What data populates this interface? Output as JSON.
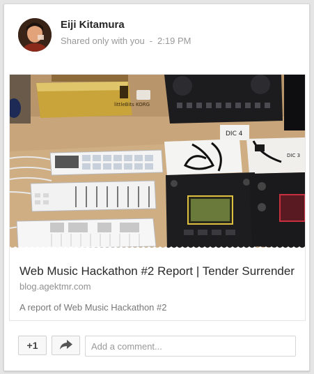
{
  "post": {
    "author": "Eiji Kitamura",
    "visibility": "Shared only with you",
    "separator": "-",
    "time": "2:19 PM"
  },
  "attachment": {
    "title": "Web Music Hackathon #2 Report | Tender Surrender",
    "domain": "blog.agektmr.com",
    "description": "A report of Web Music Hackathon #2",
    "photo_labels": {
      "box_logo": "littleBits KORG",
      "card_left": "DIC 4",
      "card_right": "DIC 3"
    }
  },
  "actions": {
    "plus_one_label": "+1",
    "share_icon": "share-arrow-icon",
    "comment_placeholder": "Add a comment..."
  },
  "colors": {
    "background": "#e5e5e5",
    "card": "#ffffff",
    "author_text": "#262626",
    "meta_text": "#999999"
  }
}
